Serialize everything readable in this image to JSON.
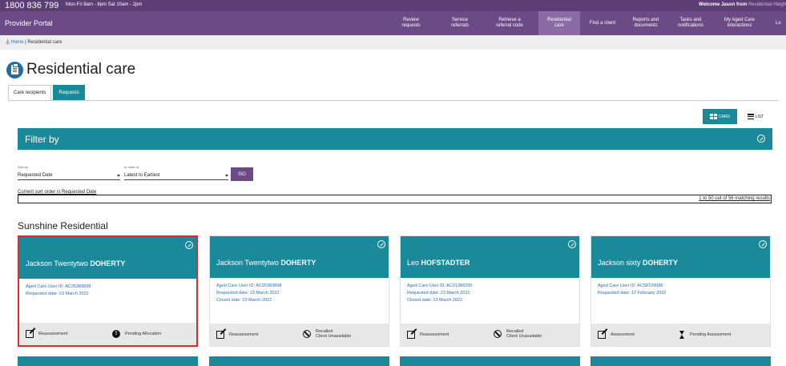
{
  "topbar": {
    "phone": "1800 836 799",
    "hours": "Mon-Fri 8am - 8pm Sat 10am - 2pm",
    "welcome_prefix": "Welcome Jason from ",
    "welcome_org": "Residential Heigh"
  },
  "nav": {
    "brand": "Provider Portal",
    "items": [
      {
        "label": "Review\nrequests"
      },
      {
        "label": "Service\nreferrals"
      },
      {
        "label": "Retrieve a\nreferral code"
      },
      {
        "label": "Residential\ncare",
        "active": true
      },
      {
        "label": "Find a client"
      },
      {
        "label": "Reports and\ndocuments"
      },
      {
        "label": "Tasks and\nnotifications"
      },
      {
        "label": "My Aged Care\ninteractions"
      },
      {
        "label": "Lo"
      }
    ]
  },
  "breadcrumb": {
    "home": "Home",
    "separator": "|",
    "current": "Residential care"
  },
  "page_title": "Residential care",
  "tabs": [
    {
      "label": "Care recipients"
    },
    {
      "label": "Requests",
      "active": true
    }
  ],
  "view_toggle": {
    "card": "CARD",
    "list": "LIST"
  },
  "filter": {
    "title": "Filter by"
  },
  "sort": {
    "sort_by_label": "Sort by",
    "sort_by_value": "Requested Date",
    "order_label": "In order of",
    "order_value": "Latest to Earliest",
    "go": "GO",
    "current_order": "Current sort order is Requested Date",
    "results": "1 to 50 out of 56 matching results"
  },
  "section_title": "Sunshine Residential",
  "cards": [
    {
      "first": "Jackson Twentytwo ",
      "last": "DOHERTY",
      "user_id": "Aged Care User ID: AC25383898",
      "requested": "Requested date: 23 March 2022",
      "closed": "",
      "action": "Reassessment",
      "status_line1": "Pending Allocation",
      "status_line2": "",
      "status_icon": "exclamation-icon",
      "selected": true
    },
    {
      "first": "Jackson Twentytwo ",
      "last": "DOHERTY",
      "user_id": "Aged Care User ID: AC25383898",
      "requested": "Requested date: 23 March 2022",
      "closed": "Closed date: 23 March 2022",
      "action": "Reassessment",
      "status_line1": "Recalled",
      "status_line2": "Client Unavailable",
      "status_icon": "no-entry-icon"
    },
    {
      "first": "Leo ",
      "last": "HOFSTADTER",
      "user_id": "Aged Care User ID: AC01386295",
      "requested": "Requested date: 23 March 2022",
      "closed": "Closed date: 23 March 2022",
      "action": "Reassessment",
      "status_line1": "Recalled",
      "status_line2": "Client Unavailable",
      "status_icon": "no-entry-icon"
    },
    {
      "first": "Jackson sixty ",
      "last": "DOHERTY",
      "user_id": "Aged Care User ID: AC58729088",
      "requested": "Requested date: 12 February 2022",
      "closed": "",
      "action": "Assessment",
      "status_line1": "Pending Assessment",
      "status_line2": "",
      "status_icon": "hourglass-icon"
    }
  ],
  "colors": {
    "purple_top": "#5c3d74",
    "purple_nav": "#6b4a86",
    "teal": "#1a8a9a",
    "selected_border": "#e12a2a"
  }
}
